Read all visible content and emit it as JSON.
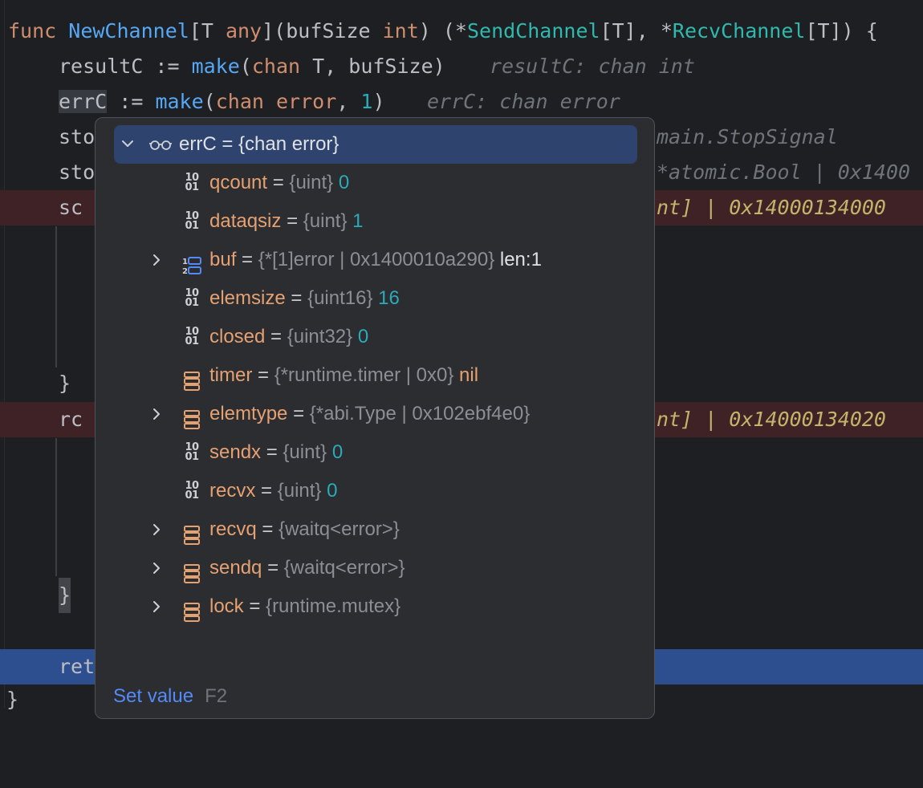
{
  "code": {
    "line1": {
      "kw": "func",
      "fn": "NewChannel",
      "a": "[T ",
      "any": "any",
      "b": "](bufSize ",
      "int": "int",
      "c": ") (*",
      "send": "SendChannel",
      "d": "[T], *",
      "recv": "RecvChannel",
      "e": "[T]) {"
    },
    "line2": {
      "a": "resultC := ",
      "make": "make",
      "b": "(",
      "chan": "chan",
      "c": " T, bufSize)",
      "hint": "resultC: chan int"
    },
    "line3": {
      "var": "errC",
      "a": " := ",
      "make": "make",
      "b": "(",
      "chan": "chan",
      "c": " ",
      "err": "error",
      "d": ", ",
      "one": "1",
      "e": ")",
      "hint": "errC: chan error"
    },
    "line4": {
      "head": "sto",
      "hint": "main.StopSignal"
    },
    "line5": {
      "head": "sto",
      "hint": "*atomic.Bool | 0x1400"
    },
    "line6": {
      "head": "sc",
      "hint": "nt] | 0x14000134000"
    },
    "line10": {
      "text": "}"
    },
    "line11": {
      "head": "rc",
      "hint": "nt] | 0x14000134020"
    },
    "line16": {
      "text": "}"
    },
    "line18": {
      "head": "ret"
    },
    "line19": {
      "text": "}"
    }
  },
  "popup": {
    "root": {
      "label": "errC = {chan error}",
      "expanded": true
    },
    "fields": [
      {
        "name": "qcount",
        "type": "{uint}",
        "value": "0",
        "icon": "binary-icon",
        "expandable": false
      },
      {
        "name": "dataqsiz",
        "type": "{uint}",
        "value": "1",
        "icon": "binary-icon",
        "expandable": false
      },
      {
        "name": "buf",
        "type": "{*[1]error | 0x1400010a290}",
        "value": "len:1",
        "icon": "array-icon",
        "expandable": true
      },
      {
        "name": "elemsize",
        "type": "{uint16}",
        "value": "16",
        "icon": "binary-icon",
        "expandable": false
      },
      {
        "name": "closed",
        "type": "{uint32}",
        "value": "0",
        "icon": "binary-icon",
        "expandable": false
      },
      {
        "name": "timer",
        "type": "{*runtime.timer | 0x0}",
        "value": "nil",
        "icon": "struct-icon",
        "expandable": false
      },
      {
        "name": "elemtype",
        "type": "{*abi.Type | 0x102ebf4e0}",
        "value": "",
        "icon": "struct-icon",
        "expandable": true
      },
      {
        "name": "sendx",
        "type": "{uint}",
        "value": "0",
        "icon": "binary-icon",
        "expandable": false
      },
      {
        "name": "recvx",
        "type": "{uint}",
        "value": "0",
        "icon": "binary-icon",
        "expandable": false
      },
      {
        "name": "recvq",
        "type": "{waitq<error>}",
        "value": "",
        "icon": "struct-icon",
        "expandable": true
      },
      {
        "name": "sendq",
        "type": "{waitq<error>}",
        "value": "",
        "icon": "struct-icon",
        "expandable": true
      },
      {
        "name": "lock",
        "type": "{runtime.mutex}",
        "value": "",
        "icon": "struct-icon",
        "expandable": true
      }
    ],
    "eq": "=",
    "bits_top": "10",
    "bits_bottom": "01",
    "footer": {
      "action": "Set value",
      "shortcut": "F2"
    }
  }
}
